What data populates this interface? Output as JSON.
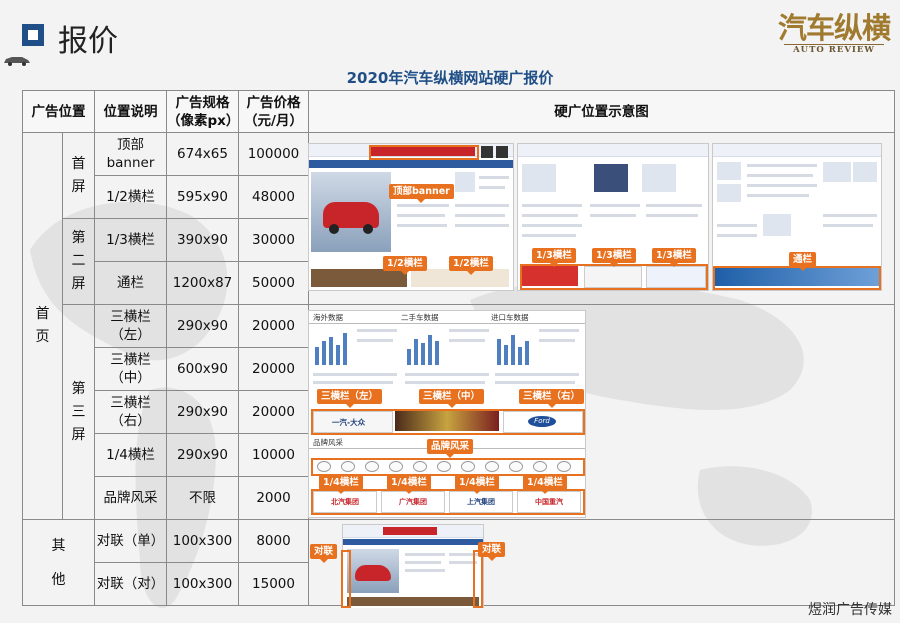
{
  "header": {
    "title": "报价"
  },
  "logo": {
    "main": "汽车纵横",
    "sub": "AUTO REVIEW"
  },
  "table_title": "2020年汽车纵横网站硬广报价",
  "columns": {
    "position": "广告位置",
    "desc": "位置说明",
    "spec": "广告规格（像素px）",
    "price": "广告价格（元/月）",
    "preview": "硬广位置示意图"
  },
  "groups": {
    "home": "首页",
    "screen1": "首屏",
    "screen2": "第二屏",
    "screen3": "第三屏",
    "other": "其他"
  },
  "rows": [
    {
      "desc": "顶部banner",
      "spec": "674x65",
      "price": "100000"
    },
    {
      "desc": "1/2横栏",
      "spec": "595x90",
      "price": "48000"
    },
    {
      "desc": "1/3横栏",
      "spec": "390x90",
      "price": "30000"
    },
    {
      "desc": "通栏",
      "spec": "1200x87",
      "price": "50000"
    },
    {
      "desc": "三横栏（左）",
      "spec": "290x90",
      "price": "20000"
    },
    {
      "desc": "三横栏（中）",
      "spec": "600x90",
      "price": "20000"
    },
    {
      "desc": "三横栏（右）",
      "spec": "290x90",
      "price": "20000"
    },
    {
      "desc": "1/4横栏",
      "spec": "290x90",
      "price": "10000"
    },
    {
      "desc": "品牌风采",
      "spec": "不限",
      "price": "2000"
    },
    {
      "desc": "对联（单）",
      "spec": "100x300",
      "price": "8000"
    },
    {
      "desc": "对联（对）",
      "spec": "100x300",
      "price": "15000"
    }
  ],
  "callouts": {
    "top_banner": "顶部banner",
    "half": "1/2横栏",
    "third": "1/3横栏",
    "through": "通栏",
    "tri_left": "三横栏（左）",
    "tri_mid": "三横栏（中）",
    "tri_right": "三横栏（右）",
    "brand": "品牌风采",
    "quarter": "1/4横栏",
    "couplet": "对联"
  },
  "preview_text": {
    "brand_section": "品牌风采",
    "sec_overseas": "海外数据",
    "sec_used": "二手车数据",
    "sec_import": "进口车数据",
    "logo_ford": "Ford",
    "logo_faw": "一汽-大众",
    "logo_baic": "北汽集团",
    "logo_gac": "广汽集团",
    "logo_saic": "上汽集团",
    "logo_sinotruk": "中国重汽"
  },
  "footer": "煜润广告传媒",
  "colors": {
    "accent": "#e8711f",
    "title_blue": "#1f4f86",
    "brand_gold": "#a07a2e"
  }
}
